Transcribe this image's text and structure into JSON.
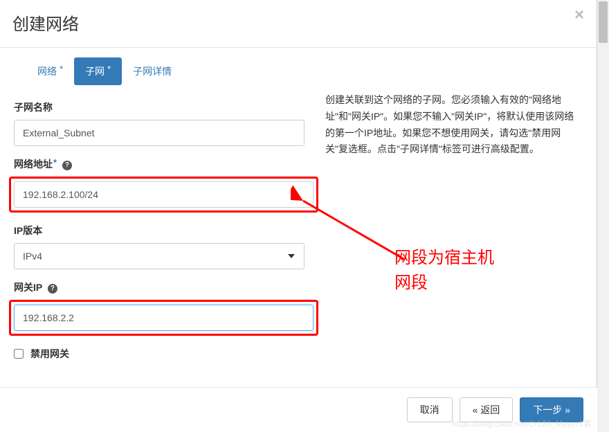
{
  "modal": {
    "title": "创建网络",
    "close": "×"
  },
  "tabs": {
    "t1": "网络",
    "t2": "子网",
    "t3": "子网详情"
  },
  "form": {
    "subnet_name_label": "子网名称",
    "subnet_name_value": "External_Subnet",
    "network_addr_label": "网络地址",
    "network_addr_value": "192.168.2.100/24",
    "ip_version_label": "IP版本",
    "ip_version_value": "IPv4",
    "gateway_ip_label": "网关IP",
    "gateway_ip_value": "192.168.2.2",
    "disable_gateway_label": "禁用网关"
  },
  "help": {
    "text": "创建关联到这个网络的子网。您必须输入有效的\"网络地址\"和\"网关IP\"。如果您不输入\"网关IP\"，将默认使用该网络的第一个IP地址。如果您不想使用网关，请勾选\"禁用网关\"复选框。点击\"子网详情\"标签可进行高级配置。"
  },
  "annotation": {
    "line1": "网段为宿主机",
    "line2": "网段"
  },
  "footer": {
    "cancel": "取消",
    "back": "«  返回",
    "next": "下一步  »"
  },
  "watermark": "https://blog.csdn.net/Cr126_Maver1客"
}
